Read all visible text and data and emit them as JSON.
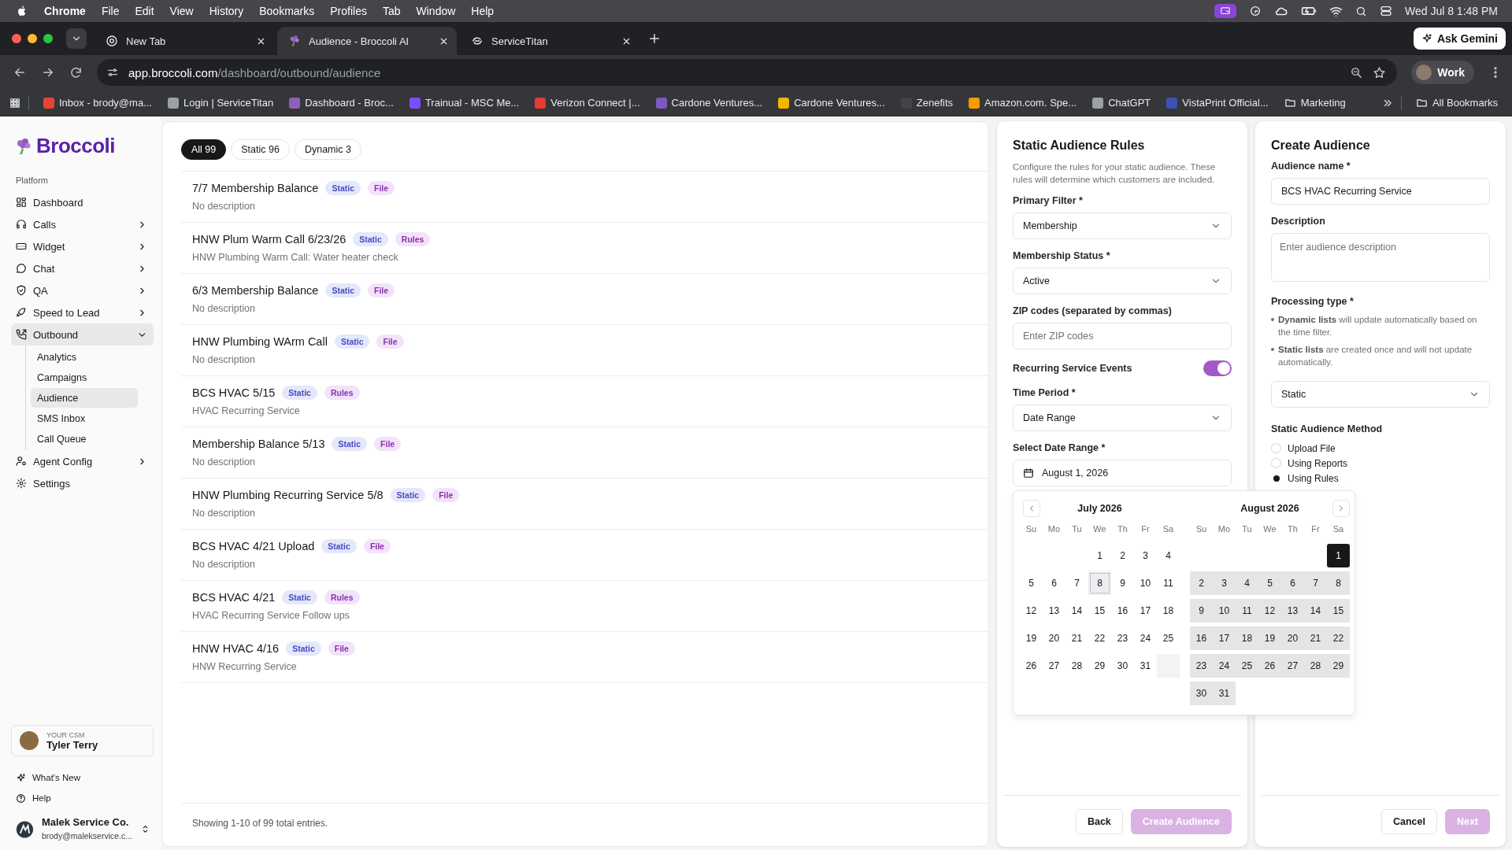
{
  "menubar": {
    "app": "Chrome",
    "menus": [
      "File",
      "Edit",
      "View",
      "History",
      "Bookmarks",
      "Profiles",
      "Tab",
      "Window",
      "Help"
    ],
    "clock": "Wed Jul 8  1:48 PM"
  },
  "tabs": [
    {
      "title": "New Tab",
      "selected": false
    },
    {
      "title": "Audience - Broccoli AI",
      "selected": true
    },
    {
      "title": "ServiceTitan",
      "selected": false
    }
  ],
  "ask_gemini": "Ask Gemini",
  "url": {
    "host": "app.broccoli.com",
    "path": "/dashboard/outbound/audience"
  },
  "profile": "Work",
  "bookmarks": [
    {
      "label": "Inbox - brody@ma...",
      "kind": "site"
    },
    {
      "label": "Login | ServiceTitan",
      "kind": "site"
    },
    {
      "label": "Dashboard - Broc...",
      "kind": "site"
    },
    {
      "label": "Trainual - MSC Me...",
      "kind": "site"
    },
    {
      "label": "Verizon Connect |...",
      "kind": "site"
    },
    {
      "label": "Cardone Ventures...",
      "kind": "site"
    },
    {
      "label": "Cardone Ventures...",
      "kind": "site"
    },
    {
      "label": "Zenefits",
      "kind": "site"
    },
    {
      "label": "Amazon.com. Spe...",
      "kind": "site"
    },
    {
      "label": "ChatGPT",
      "kind": "site"
    },
    {
      "label": "VistaPrint Official...",
      "kind": "site"
    },
    {
      "label": "Marketing",
      "kind": "folder"
    }
  ],
  "all_bookmarks": "All Bookmarks",
  "sidebar": {
    "brand": "Broccoli",
    "section": "Platform",
    "items": [
      {
        "label": "Dashboard",
        "selected": false
      },
      {
        "label": "Calls",
        "selected": false,
        "expanded": false
      },
      {
        "label": "Widget",
        "selected": false,
        "expanded": false
      },
      {
        "label": "Chat",
        "selected": false,
        "expanded": false
      },
      {
        "label": "QA",
        "selected": false,
        "expanded": false
      },
      {
        "label": "Speed to Lead",
        "selected": false,
        "expanded": false
      },
      {
        "label": "Outbound",
        "selected": true,
        "expanded": true,
        "children": [
          {
            "label": "Analytics",
            "selected": false
          },
          {
            "label": "Campaigns",
            "selected": false
          },
          {
            "label": "Audience",
            "selected": true
          },
          {
            "label": "SMS Inbox",
            "selected": false
          },
          {
            "label": "Call Queue",
            "selected": false
          }
        ]
      },
      {
        "label": "Agent Config",
        "selected": false,
        "expanded": false
      },
      {
        "label": "Settings",
        "selected": false
      }
    ],
    "csm": {
      "caption": "YOUR CSM",
      "name": "Tyler Terry"
    },
    "links": [
      "What's New",
      "Help"
    ],
    "org": {
      "name": "Malek Service Co.",
      "email": "brody@malekservice.c..."
    }
  },
  "filters": [
    {
      "label": "All 99",
      "selected": true
    },
    {
      "label": "Static 96",
      "selected": false
    },
    {
      "label": "Dynamic 3",
      "selected": false
    }
  ],
  "audiences": [
    {
      "name": "7/7 Membership Balance",
      "tags": [
        {
          "label": "Static",
          "kind": "type"
        },
        {
          "label": "File",
          "kind": "source"
        }
      ],
      "description": "No description"
    },
    {
      "name": "HNW Plum Warm Call 6/23/26",
      "tags": [
        {
          "label": "Static",
          "kind": "type"
        },
        {
          "label": "Rules",
          "kind": "source"
        }
      ],
      "description": "HNW Plumbing Warm Call: Water heater check"
    },
    {
      "name": "6/3 Membership Balance",
      "tags": [
        {
          "label": "Static",
          "kind": "type"
        },
        {
          "label": "File",
          "kind": "source"
        }
      ],
      "description": "No description"
    },
    {
      "name": "HNW Plumbing WArm Call",
      "tags": [
        {
          "label": "Static",
          "kind": "type"
        },
        {
          "label": "File",
          "kind": "source"
        }
      ],
      "description": "No description"
    },
    {
      "name": "BCS HVAC 5/15",
      "tags": [
        {
          "label": "Static",
          "kind": "type"
        },
        {
          "label": "Rules",
          "kind": "source"
        }
      ],
      "description": "HVAC Recurring Service"
    },
    {
      "name": "Membership Balance 5/13",
      "tags": [
        {
          "label": "Static",
          "kind": "type"
        },
        {
          "label": "File",
          "kind": "source"
        }
      ],
      "description": "No description"
    },
    {
      "name": "HNW Plumbing Recurring Service 5/8",
      "tags": [
        {
          "label": "Static",
          "kind": "type"
        },
        {
          "label": "File",
          "kind": "source"
        }
      ],
      "description": "No description"
    },
    {
      "name": "BCS HVAC 4/21 Upload",
      "tags": [
        {
          "label": "Static",
          "kind": "type"
        },
        {
          "label": "File",
          "kind": "source"
        }
      ],
      "description": "No description"
    },
    {
      "name": "BCS HVAC 4/21",
      "tags": [
        {
          "label": "Static",
          "kind": "type"
        },
        {
          "label": "Rules",
          "kind": "source"
        }
      ],
      "description": "HVAC Recurring Service Follow ups"
    },
    {
      "name": "HNW HVAC 4/16",
      "tags": [
        {
          "label": "Static",
          "kind": "type"
        },
        {
          "label": "File",
          "kind": "source"
        }
      ],
      "description": "HNW Recurring Service"
    }
  ],
  "pagination": "Showing 1-10 of 99 total entries.",
  "rules_panel": {
    "title": "Static Audience Rules",
    "description": "Configure the rules for your static audience. These rules will determine which customers are included.",
    "fields": [
      {
        "kind": "select",
        "label": "Primary Filter *",
        "value": "Membership"
      },
      {
        "kind": "select",
        "label": "Membership Status *",
        "value": "Active"
      },
      {
        "kind": "input",
        "label": "ZIP codes (separated by commas)",
        "placeholder": "Enter ZIP codes"
      },
      {
        "kind": "toggle",
        "label": "Recurring Service Events",
        "on": true
      },
      {
        "kind": "select",
        "label": "Time Period *",
        "value": "Date Range"
      },
      {
        "kind": "date",
        "label": "Select Date Range *",
        "value": "August 1, 2026"
      }
    ],
    "back": "Back",
    "submit": {
      "label": "Create Audience",
      "disabled": true
    }
  },
  "calendar": {
    "months": [
      {
        "title": "July 2026",
        "weekdays": [
          "Su",
          "Mo",
          "Tu",
          "We",
          "Th",
          "Fr",
          "Sa"
        ],
        "days": [
          {
            "kind": "blank"
          },
          {
            "kind": "blank"
          },
          {
            "kind": "blank"
          },
          {
            "kind": "day",
            "label": "1",
            "today": false,
            "in_range": false,
            "selected": false
          },
          {
            "kind": "day",
            "label": "2",
            "today": false,
            "in_range": false,
            "selected": false
          },
          {
            "kind": "day",
            "label": "3",
            "today": false,
            "in_range": false,
            "selected": false
          },
          {
            "kind": "day",
            "label": "4",
            "today": false,
            "in_range": false,
            "selected": false
          },
          {
            "kind": "day",
            "label": "5",
            "today": false,
            "in_range": false,
            "selected": false
          },
          {
            "kind": "day",
            "label": "6",
            "today": false,
            "in_range": false,
            "selected": false
          },
          {
            "kind": "day",
            "label": "7",
            "today": false,
            "in_range": false,
            "selected": false
          },
          {
            "kind": "day",
            "label": "8",
            "today": true,
            "in_range": false,
            "selected": false
          },
          {
            "kind": "day",
            "label": "9",
            "today": false,
            "in_range": false,
            "selected": false
          },
          {
            "kind": "day",
            "label": "10",
            "today": false,
            "in_range": false,
            "selected": false
          },
          {
            "kind": "day",
            "label": "11",
            "today": false,
            "in_range": false,
            "selected": false
          },
          {
            "kind": "day",
            "label": "12",
            "today": false,
            "in_range": false,
            "selected": false
          },
          {
            "kind": "day",
            "label": "13",
            "today": false,
            "in_range": false,
            "selected": false
          },
          {
            "kind": "day",
            "label": "14",
            "today": false,
            "in_range": false,
            "selected": false
          },
          {
            "kind": "day",
            "label": "15",
            "today": false,
            "in_range": false,
            "selected": false
          },
          {
            "kind": "day",
            "label": "16",
            "today": false,
            "in_range": false,
            "selected": false
          },
          {
            "kind": "day",
            "label": "17",
            "today": false,
            "in_range": false,
            "selected": false
          },
          {
            "kind": "day",
            "label": "18",
            "today": false,
            "in_range": false,
            "selected": false
          },
          {
            "kind": "day",
            "label": "19",
            "today": false,
            "in_range": false,
            "selected": false
          },
          {
            "kind": "day",
            "label": "20",
            "today": false,
            "in_range": false,
            "selected": false
          },
          {
            "kind": "day",
            "label": "21",
            "today": false,
            "in_range": false,
            "selected": false
          },
          {
            "kind": "day",
            "label": "22",
            "today": false,
            "in_range": false,
            "selected": false
          },
          {
            "kind": "day",
            "label": "23",
            "today": false,
            "in_range": false,
            "selected": false
          },
          {
            "kind": "day",
            "label": "24",
            "today": false,
            "in_range": false,
            "selected": false
          },
          {
            "kind": "day",
            "label": "25",
            "today": false,
            "in_range": false,
            "selected": false
          },
          {
            "kind": "day",
            "label": "26",
            "today": false,
            "in_range": false,
            "selected": false
          },
          {
            "kind": "day",
            "label": "27",
            "today": false,
            "in_range": false,
            "selected": false
          },
          {
            "kind": "day",
            "label": "28",
            "today": false,
            "in_range": false,
            "selected": false
          },
          {
            "kind": "day",
            "label": "29",
            "today": false,
            "in_range": false,
            "selected": false
          },
          {
            "kind": "day",
            "label": "30",
            "today": false,
            "in_range": false,
            "selected": false
          },
          {
            "kind": "day",
            "label": "31",
            "today": false,
            "in_range": false,
            "selected": false
          },
          {
            "kind": "outside",
            "in_range": true
          }
        ]
      },
      {
        "title": "August 2026",
        "weekdays": [
          "Su",
          "Mo",
          "Tu",
          "We",
          "Th",
          "Fr",
          "Sa"
        ],
        "days": [
          {
            "kind": "blank"
          },
          {
            "kind": "blank"
          },
          {
            "kind": "blank"
          },
          {
            "kind": "blank"
          },
          {
            "kind": "blank"
          },
          {
            "kind": "blank"
          },
          {
            "kind": "day",
            "label": "1",
            "today": false,
            "in_range": false,
            "selected": true
          },
          {
            "kind": "day",
            "label": "2",
            "today": false,
            "in_range": true,
            "selected": false
          },
          {
            "kind": "day",
            "label": "3",
            "today": false,
            "in_range": true,
            "selected": false
          },
          {
            "kind": "day",
            "label": "4",
            "today": false,
            "in_range": true,
            "selected": false
          },
          {
            "kind": "day",
            "label": "5",
            "today": false,
            "in_range": true,
            "selected": false
          },
          {
            "kind": "day",
            "label": "6",
            "today": false,
            "in_range": true,
            "selected": false
          },
          {
            "kind": "day",
            "label": "7",
            "today": false,
            "in_range": true,
            "selected": false
          },
          {
            "kind": "day",
            "label": "8",
            "today": false,
            "in_range": true,
            "selected": false
          },
          {
            "kind": "day",
            "label": "9",
            "today": false,
            "in_range": true,
            "selected": false
          },
          {
            "kind": "day",
            "label": "10",
            "today": false,
            "in_range": true,
            "selected": false
          },
          {
            "kind": "day",
            "label": "11",
            "today": false,
            "in_range": true,
            "selected": false
          },
          {
            "kind": "day",
            "label": "12",
            "today": false,
            "in_range": true,
            "selected": false
          },
          {
            "kind": "day",
            "label": "13",
            "today": false,
            "in_range": true,
            "selected": false
          },
          {
            "kind": "day",
            "label": "14",
            "today": false,
            "in_range": true,
            "selected": false
          },
          {
            "kind": "day",
            "label": "15",
            "today": false,
            "in_range": true,
            "selected": false
          },
          {
            "kind": "day",
            "label": "16",
            "today": false,
            "in_range": true,
            "selected": false
          },
          {
            "kind": "day",
            "label": "17",
            "today": false,
            "in_range": true,
            "selected": false
          },
          {
            "kind": "day",
            "label": "18",
            "today": false,
            "in_range": true,
            "selected": false
          },
          {
            "kind": "day",
            "label": "19",
            "today": false,
            "in_range": true,
            "selected": false
          },
          {
            "kind": "day",
            "label": "20",
            "today": false,
            "in_range": true,
            "selected": false
          },
          {
            "kind": "day",
            "label": "21",
            "today": false,
            "in_range": true,
            "selected": false
          },
          {
            "kind": "day",
            "label": "22",
            "today": false,
            "in_range": true,
            "selected": false
          },
          {
            "kind": "day",
            "label": "23",
            "today": false,
            "in_range": true,
            "selected": false
          },
          {
            "kind": "day",
            "label": "24",
            "today": false,
            "in_range": true,
            "selected": false
          },
          {
            "kind": "day",
            "label": "25",
            "today": false,
            "in_range": true,
            "selected": false
          },
          {
            "kind": "day",
            "label": "26",
            "today": false,
            "in_range": true,
            "selected": false
          },
          {
            "kind": "day",
            "label": "27",
            "today": false,
            "in_range": true,
            "selected": false
          },
          {
            "kind": "day",
            "label": "28",
            "today": false,
            "in_range": true,
            "selected": false
          },
          {
            "kind": "day",
            "label": "29",
            "today": false,
            "in_range": true,
            "selected": false
          },
          {
            "kind": "day",
            "label": "30",
            "today": false,
            "in_range": true,
            "selected": false
          },
          {
            "kind": "day",
            "label": "31",
            "today": false,
            "in_range": true,
            "selected": false
          }
        ]
      }
    ]
  },
  "create_panel": {
    "title": "Create Audience",
    "name_label": "Audience name *",
    "name_value": "BCS HVAC Recurring Service",
    "description_label": "Description",
    "description_placeholder": "Enter audience description",
    "processing_label": "Processing type *",
    "notes": [
      "**Dynamic lists** will update automatically based on the time filter.",
      "**Static lists** are created once and will not update automatically."
    ],
    "processing_value": "Static",
    "method_label": "Static Audience Method",
    "methods": [
      {
        "label": "Upload File",
        "selected": false
      },
      {
        "label": "Using Reports",
        "selected": false
      },
      {
        "label": "Using Rules",
        "selected": true
      }
    ],
    "cancel": "Cancel",
    "next": {
      "label": "Next",
      "disabled": true
    }
  }
}
